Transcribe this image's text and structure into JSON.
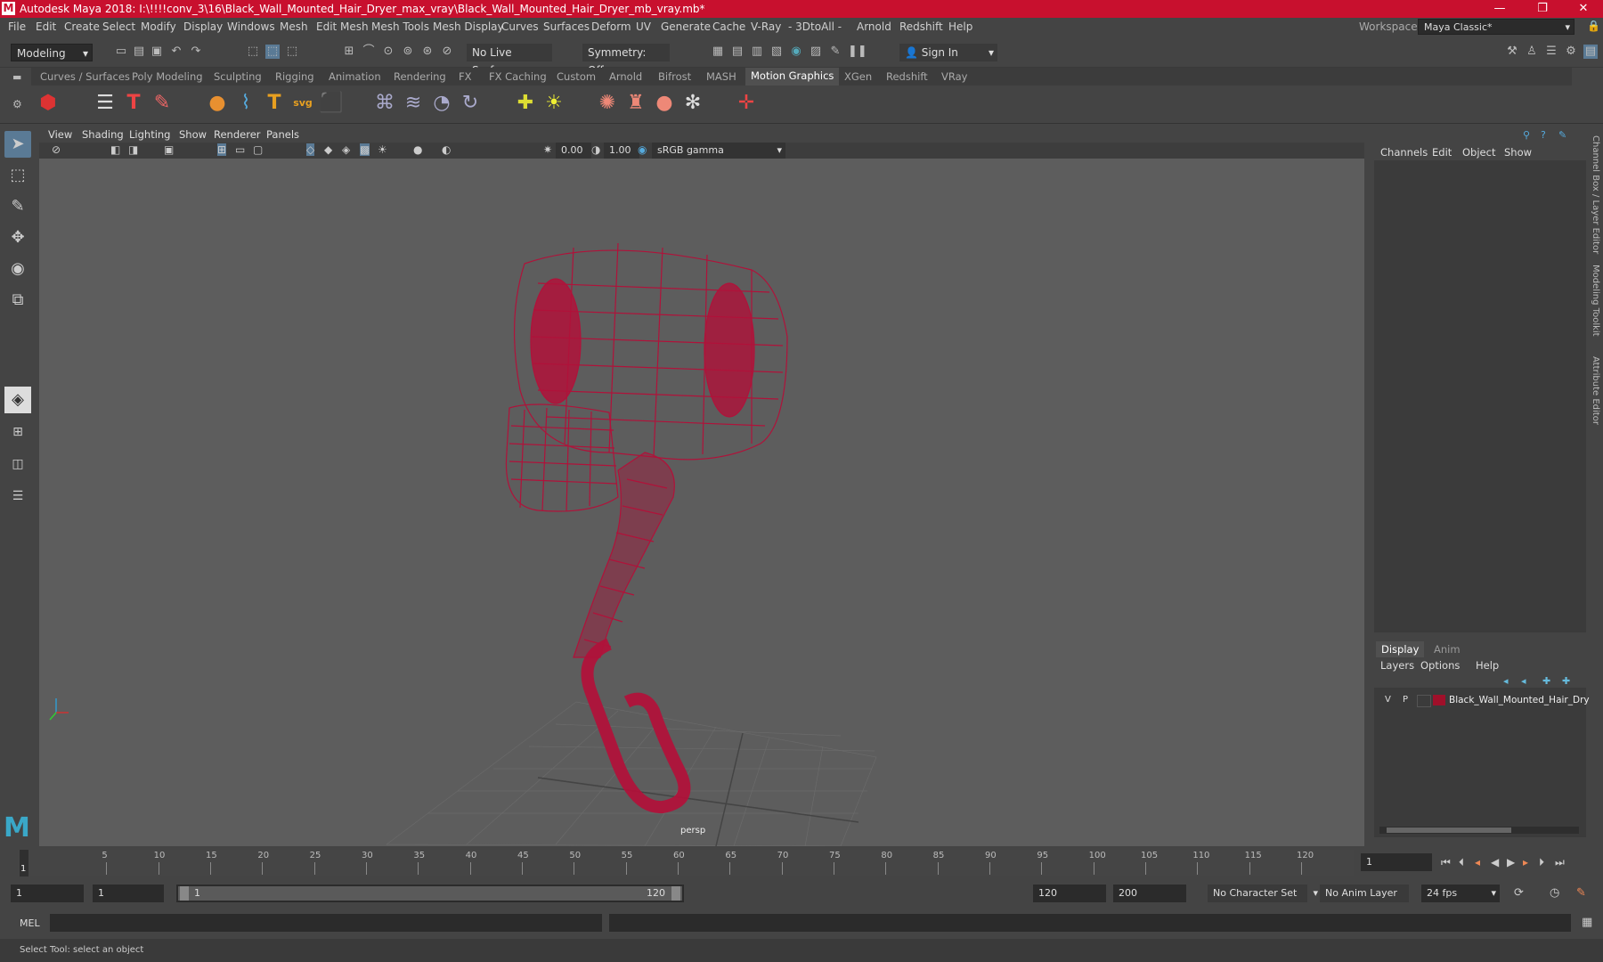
{
  "titlebar": {
    "logo": "M",
    "title": "Autodesk Maya 2018: I:\\!!!!conv_3\\16\\Black_Wall_Mounted_Hair_Dryer_max_vray\\Black_Wall_Mounted_Hair_Dryer_mb_vray.mb*",
    "minimize": "—",
    "restore": "❐",
    "close": "✕"
  },
  "menubar": {
    "items": [
      "File",
      "Edit",
      "Create",
      "Select",
      "Modify",
      "Display",
      "Windows",
      "Mesh",
      "Edit Mesh",
      "Mesh Tools",
      "Mesh Display",
      "Curves",
      "Surfaces",
      "Deform",
      "UV",
      "Generate",
      "Cache",
      "V-Ray",
      "- 3DtoAll -",
      "Arnold",
      "Redshift",
      "Help"
    ],
    "workspace_label": "Workspace :",
    "workspace_value": "Maya Classic*"
  },
  "statusline": {
    "mode": "Modeling",
    "live_surface": "No Live Surface",
    "symmetry": "Symmetry: Off",
    "sign_in": "Sign In"
  },
  "shelf": {
    "tabs": [
      "Curves / Surfaces",
      "Poly Modeling",
      "Sculpting",
      "Rigging",
      "Animation",
      "Rendering",
      "FX",
      "FX Caching",
      "Custom",
      "Arnold",
      "Bifrost",
      "MASH",
      "Motion Graphics",
      "XGen",
      "Redshift",
      "VRay"
    ],
    "active_tab": "Motion Graphics"
  },
  "viewport": {
    "menu": [
      "View",
      "Shading",
      "Lighting",
      "Show",
      "Renderer",
      "Panels"
    ],
    "exposure": "0.00",
    "gamma": "1.00",
    "color_space": "sRGB gamma",
    "camera_label": "persp",
    "wire_color": "#b0123a"
  },
  "channelbox": {
    "menu": [
      "Channels",
      "Edit",
      "Object",
      "Show"
    ]
  },
  "layereditor": {
    "tabs": [
      "Display",
      "Anim"
    ],
    "menu": [
      "Layers",
      "Options",
      "Help"
    ],
    "layer": {
      "v": "V",
      "p": "P",
      "name": "Black_Wall_Mounted_Hair_Dry",
      "color": "#a0102a"
    }
  },
  "sidetabs": [
    "Channel Box / Layer Editor",
    "Modeling Toolkit",
    "Attribute Editor"
  ],
  "timeslider": {
    "ticks": [
      "5",
      "10",
      "15",
      "20",
      "25",
      "30",
      "35",
      "40",
      "45",
      "50",
      "55",
      "60",
      "65",
      "70",
      "75",
      "80",
      "85",
      "90",
      "95",
      "100",
      "105",
      "110",
      "115",
      "120"
    ],
    "current_marker": "1",
    "current_frame": "1"
  },
  "rangeslider": {
    "start": "1",
    "anim_start": "1",
    "range_start": "1",
    "range_end": "120",
    "anim_end_field": "120",
    "end": "200",
    "character_set": "No Character Set",
    "anim_layer": "No Anim Layer",
    "fps": "24 fps"
  },
  "cmdline": {
    "label": "MEL"
  },
  "helpline": {
    "text": "Select Tool: select an object"
  }
}
